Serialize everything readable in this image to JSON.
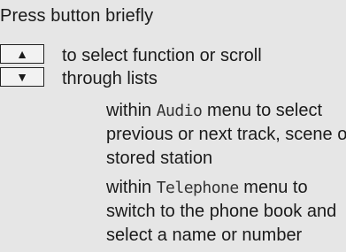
{
  "heading": "Press button briefly",
  "keys": {
    "up_symbol": "▲",
    "down_symbol": "▼"
  },
  "scroll_text": {
    "line1": "to select function or scroll",
    "line2": "through lists"
  },
  "audio_block": {
    "prefix": "within ",
    "menu": "Audio",
    "line1_rest": " menu to select",
    "line2": "previous or next track, scene or",
    "line3": "stored station"
  },
  "telephone_block": {
    "prefix": "within ",
    "menu": "Telephone",
    "line1_rest": " menu to",
    "line2": "switch to the phone book and",
    "line3": "select a name or number"
  }
}
